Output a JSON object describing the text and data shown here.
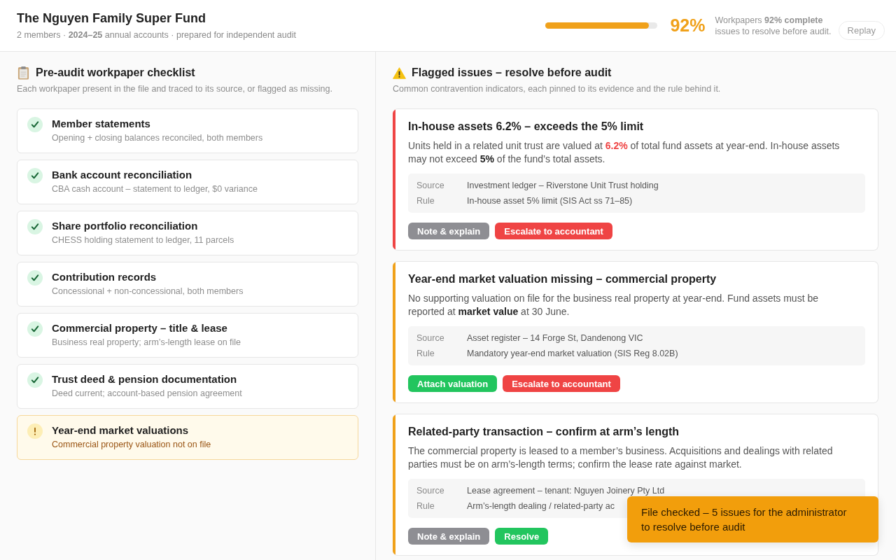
{
  "header": {
    "title": "The Nguyen Family Super Fund",
    "subtitle": "2 members · **2024–25** annual accounts · prepared for independent audit",
    "progress": {
      "level": 0.92
    },
    "percent": "92%",
    "summary": [
      "Workpapers **92% complete**",
      "issues to resolve before audit."
    ],
    "replay_button": "Replay"
  },
  "checklist": {
    "title": "Pre-audit workpaper checklist",
    "subtitle": "Each workpaper present in the file and traced to its source, or flagged as missing.",
    "items": [
      {
        "title": "Member statements",
        "detail": "Opening + closing balances reconciled, both members",
        "complete": true
      },
      {
        "title": "Bank account reconciliation",
        "detail": "CBA cash account – statement to ledger, $0 variance",
        "complete": true
      },
      {
        "title": "Share portfolio reconciliation",
        "detail": "CHESS holding statement to ledger, 11 parcels",
        "complete": true
      },
      {
        "title": "Contribution records",
        "detail": "Concessional + non-concessional, both members",
        "complete": true
      },
      {
        "title": "Commercial property – title & lease",
        "detail": "Business real property; arm’s-length lease on file",
        "complete": true
      },
      {
        "title": "Trust deed & pension documentation",
        "detail": "Deed current; account-based pension agreement",
        "complete": true
      },
      {
        "title": "Year-end market valuations",
        "detail": "Commercial property valuation not on file",
        "complete": false
      }
    ]
  },
  "issues": {
    "title": "Flagged issues – resolve before audit",
    "subtitle": "Common contravention indicators, each pinned to its evidence and the rule behind it.",
    "items": [
      {
        "title": "In-house assets 6.2% – exceeds the 5% limit",
        "color": "#ef4444",
        "description": [
          {
            "text": "Units held in a related unit trust are valued at ",
            "kind": "text"
          },
          {
            "text": "6.2%",
            "kind": "alert"
          },
          {
            "text": " of total fund assets at year-end. In-house assets may not exceed ",
            "kind": "text"
          },
          {
            "text": "5%",
            "kind": "strong"
          },
          {
            "text": " of the fund’s total assets.",
            "kind": "text"
          }
        ],
        "evidence": [
          {
            "label": "Source",
            "value": "Investment ledger – Riverstone Unit Trust holding"
          },
          {
            "label": "Rule",
            "value": "In-house asset 5% limit (SIS Act ss 71–85)"
          }
        ],
        "actions": [
          {
            "label": "Note & explain",
            "kind": "neutral"
          },
          {
            "label": "Escalate to accountant",
            "kind": "danger"
          }
        ]
      },
      {
        "title": "Year-end market valuation missing – commercial property",
        "color": "#f0a11a",
        "description": [
          {
            "text": "No supporting valuation on file for the business real property at year-end. Fund assets must be reported at ",
            "kind": "text"
          },
          {
            "text": "market value",
            "kind": "strong"
          },
          {
            "text": " at 30 June.",
            "kind": "text"
          }
        ],
        "evidence": [
          {
            "label": "Source",
            "value": "Asset register – 14 Forge St, Dandenong VIC"
          },
          {
            "label": "Rule",
            "value": "Mandatory year-end market valuation (SIS Reg 8.02B)"
          }
        ],
        "actions": [
          {
            "label": "Attach valuation",
            "kind": "success"
          },
          {
            "label": "Escalate to accountant",
            "kind": "danger"
          }
        ]
      },
      {
        "title": "Related-party transaction – confirm at arm’s length",
        "color": "#f0a11a",
        "description": [
          {
            "text": "The commercial property is leased to a member’s business. Acquisitions and dealings with related parties must be on arm’s-length terms; confirm the lease rate against market.",
            "kind": "text"
          }
        ],
        "evidence": [
          {
            "label": "Source",
            "value": "Lease agreement – tenant: Nguyen Joinery Pty Ltd"
          },
          {
            "label": "Rule",
            "value": "Arm’s-length dealing / related-party ac"
          }
        ],
        "actions": [
          {
            "label": "Note & explain",
            "kind": "neutral"
          },
          {
            "label": "Resolve",
            "kind": "success"
          }
        ]
      }
    ]
  },
  "toast": "File checked – 5 issues for the administrator to resolve before audit"
}
